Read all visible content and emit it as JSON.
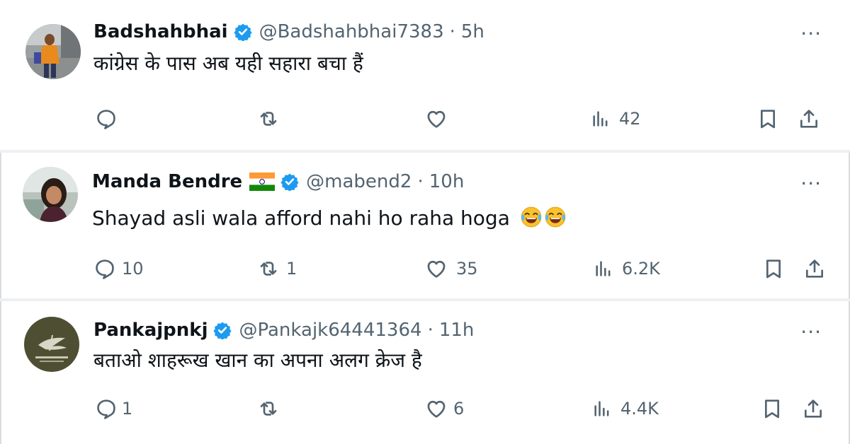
{
  "tweets": [
    {
      "name": "Badshahbhai",
      "handle": "@Badshahbhai7383",
      "separator": "·",
      "time": "5h",
      "text": "कांग्रेस के पास अब यही सहारा बचा हैं",
      "reply_count": "",
      "retweet_count": "",
      "like_count": "",
      "views": "42",
      "more": "···"
    },
    {
      "name": "Manda Bendre",
      "handle": "@mabend2",
      "separator": "·",
      "time": "10h",
      "text": "Shayad asli wala afford nahi ho raha hoga",
      "reply_count": "10",
      "retweet_count": "1",
      "like_count": "35",
      "views": "6.2K",
      "more": "···"
    },
    {
      "name": "Pankajpnkj",
      "handle": "@Pankajk64441364",
      "separator": "·",
      "time": "11h",
      "text": "बताओ शाहरूख खान का अपना अलग क्रेज है",
      "reply_count": "1",
      "retweet_count": "",
      "like_count": "6",
      "views": "4.4K",
      "more": "···"
    }
  ],
  "colors": {
    "verified": "#1d9bf0",
    "muted": "#536471",
    "text": "#0f1419"
  },
  "icons": [
    "reply-icon",
    "retweet-icon",
    "like-icon",
    "views-icon",
    "bookmark-icon",
    "share-icon",
    "verified-badge-icon",
    "india-flag-icon",
    "laughing-tears-emoji"
  ]
}
